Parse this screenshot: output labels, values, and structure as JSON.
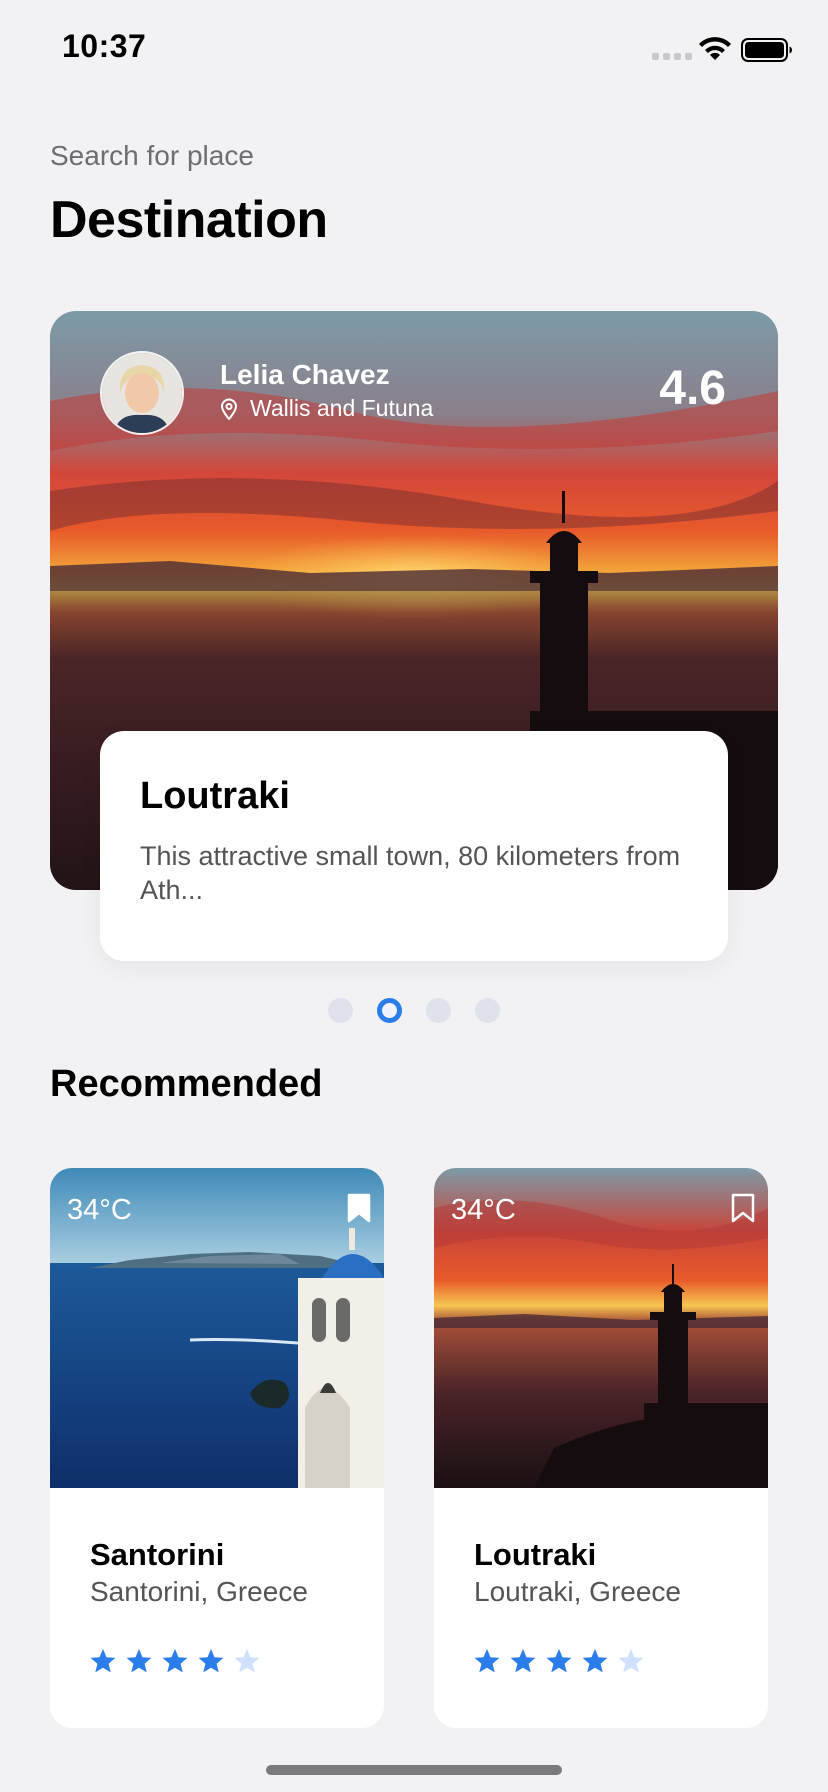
{
  "status_bar": {
    "time": "10:37"
  },
  "header": {
    "subtitle": "Search for place",
    "title": "Destination"
  },
  "featured": {
    "user_name": "Lelia Chavez",
    "location": "Wallis and Futuna",
    "rating": "4.6",
    "card_title": "Loutraki",
    "card_description": "This attractive small town, 80 kilometers from Ath...",
    "carousel_pages": 4,
    "carousel_active_index": 1
  },
  "recommended": {
    "section_title": "Recommended",
    "items": [
      {
        "temperature": "34°C",
        "name": "Santorini",
        "location": "Santorini, Greece",
        "rating": 4,
        "max_rating": 5,
        "bookmarked": true,
        "image": "santorini-sea-church"
      },
      {
        "temperature": "34°C",
        "name": "Loutraki",
        "location": "Loutraki, Greece",
        "rating": 4,
        "max_rating": 5,
        "bookmarked": false,
        "image": "sunset-lighthouse"
      }
    ]
  },
  "colors": {
    "accent": "#2b7dea",
    "star_empty": "#cfe0fb",
    "background": "#f2f2f4"
  },
  "icons": [
    "wifi-icon",
    "battery-icon",
    "location-pin-icon",
    "bookmark-icon",
    "star-icon"
  ]
}
